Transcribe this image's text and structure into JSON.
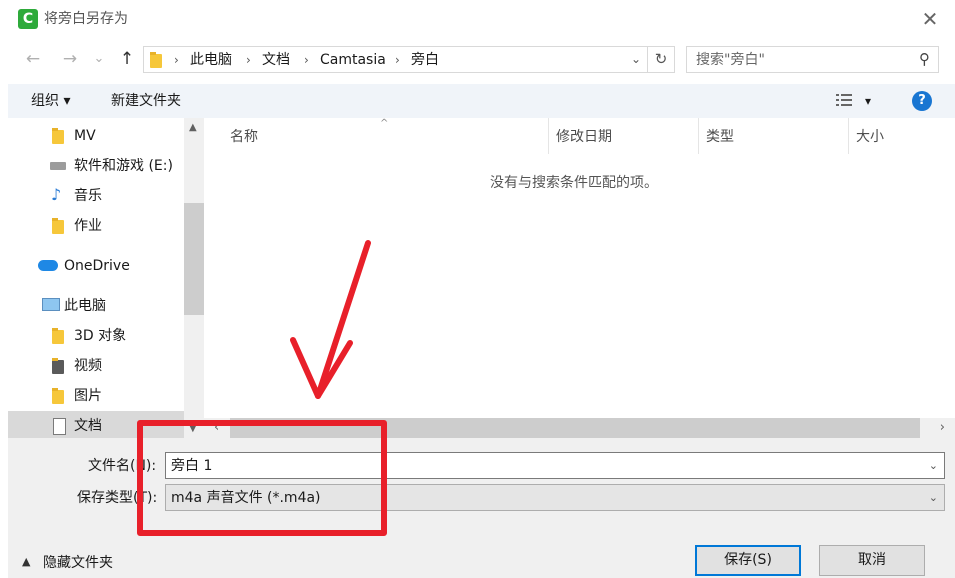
{
  "window": {
    "title": "将旁白另存为",
    "app_icon_letter": "C"
  },
  "nav": {
    "back": "←",
    "forward": "→",
    "recent": "⌄",
    "up": "↑",
    "breadcrumb": [
      "此电脑",
      "文档",
      "Camtasia",
      "旁白"
    ],
    "search_placeholder": "搜索\"旁白\""
  },
  "toolbar": {
    "organize": "组织 ▾",
    "new_folder": "新建文件夹",
    "view_arrow": "▾",
    "help": "?"
  },
  "sidebar": {
    "items": [
      {
        "label": "MV",
        "icon": "folder-icon"
      },
      {
        "label": "软件和游戏 (E:)",
        "icon": "drive-icon"
      },
      {
        "label": "音乐",
        "icon": "music-folder-icon"
      },
      {
        "label": "作业",
        "icon": "folder-icon"
      },
      {
        "label": "OneDrive",
        "icon": "cloud-icon"
      },
      {
        "label": "此电脑",
        "icon": "computer-icon"
      },
      {
        "label": "3D 对象",
        "icon": "3d-folder-icon"
      },
      {
        "label": "视频",
        "icon": "video-folder-icon"
      },
      {
        "label": "图片",
        "icon": "picture-folder-icon"
      },
      {
        "label": "文档",
        "icon": "document-folder-icon",
        "selected": true
      }
    ]
  },
  "columns": [
    "名称",
    "修改日期",
    "类型",
    "大小"
  ],
  "empty_message": "没有与搜索条件匹配的项。",
  "form": {
    "filename_label": "文件名(N):",
    "filename_value": "旁白 1",
    "filetype_label": "保存类型(T):",
    "filetype_value": "m4a 声音文件 (*.m4a)"
  },
  "footer": {
    "hide_folders": "隐藏文件夹",
    "save": "保存(S)",
    "cancel": "取消"
  },
  "colors": {
    "accent": "#0078d7",
    "annotation": "#e8202a",
    "folder": "#f6c73a"
  }
}
